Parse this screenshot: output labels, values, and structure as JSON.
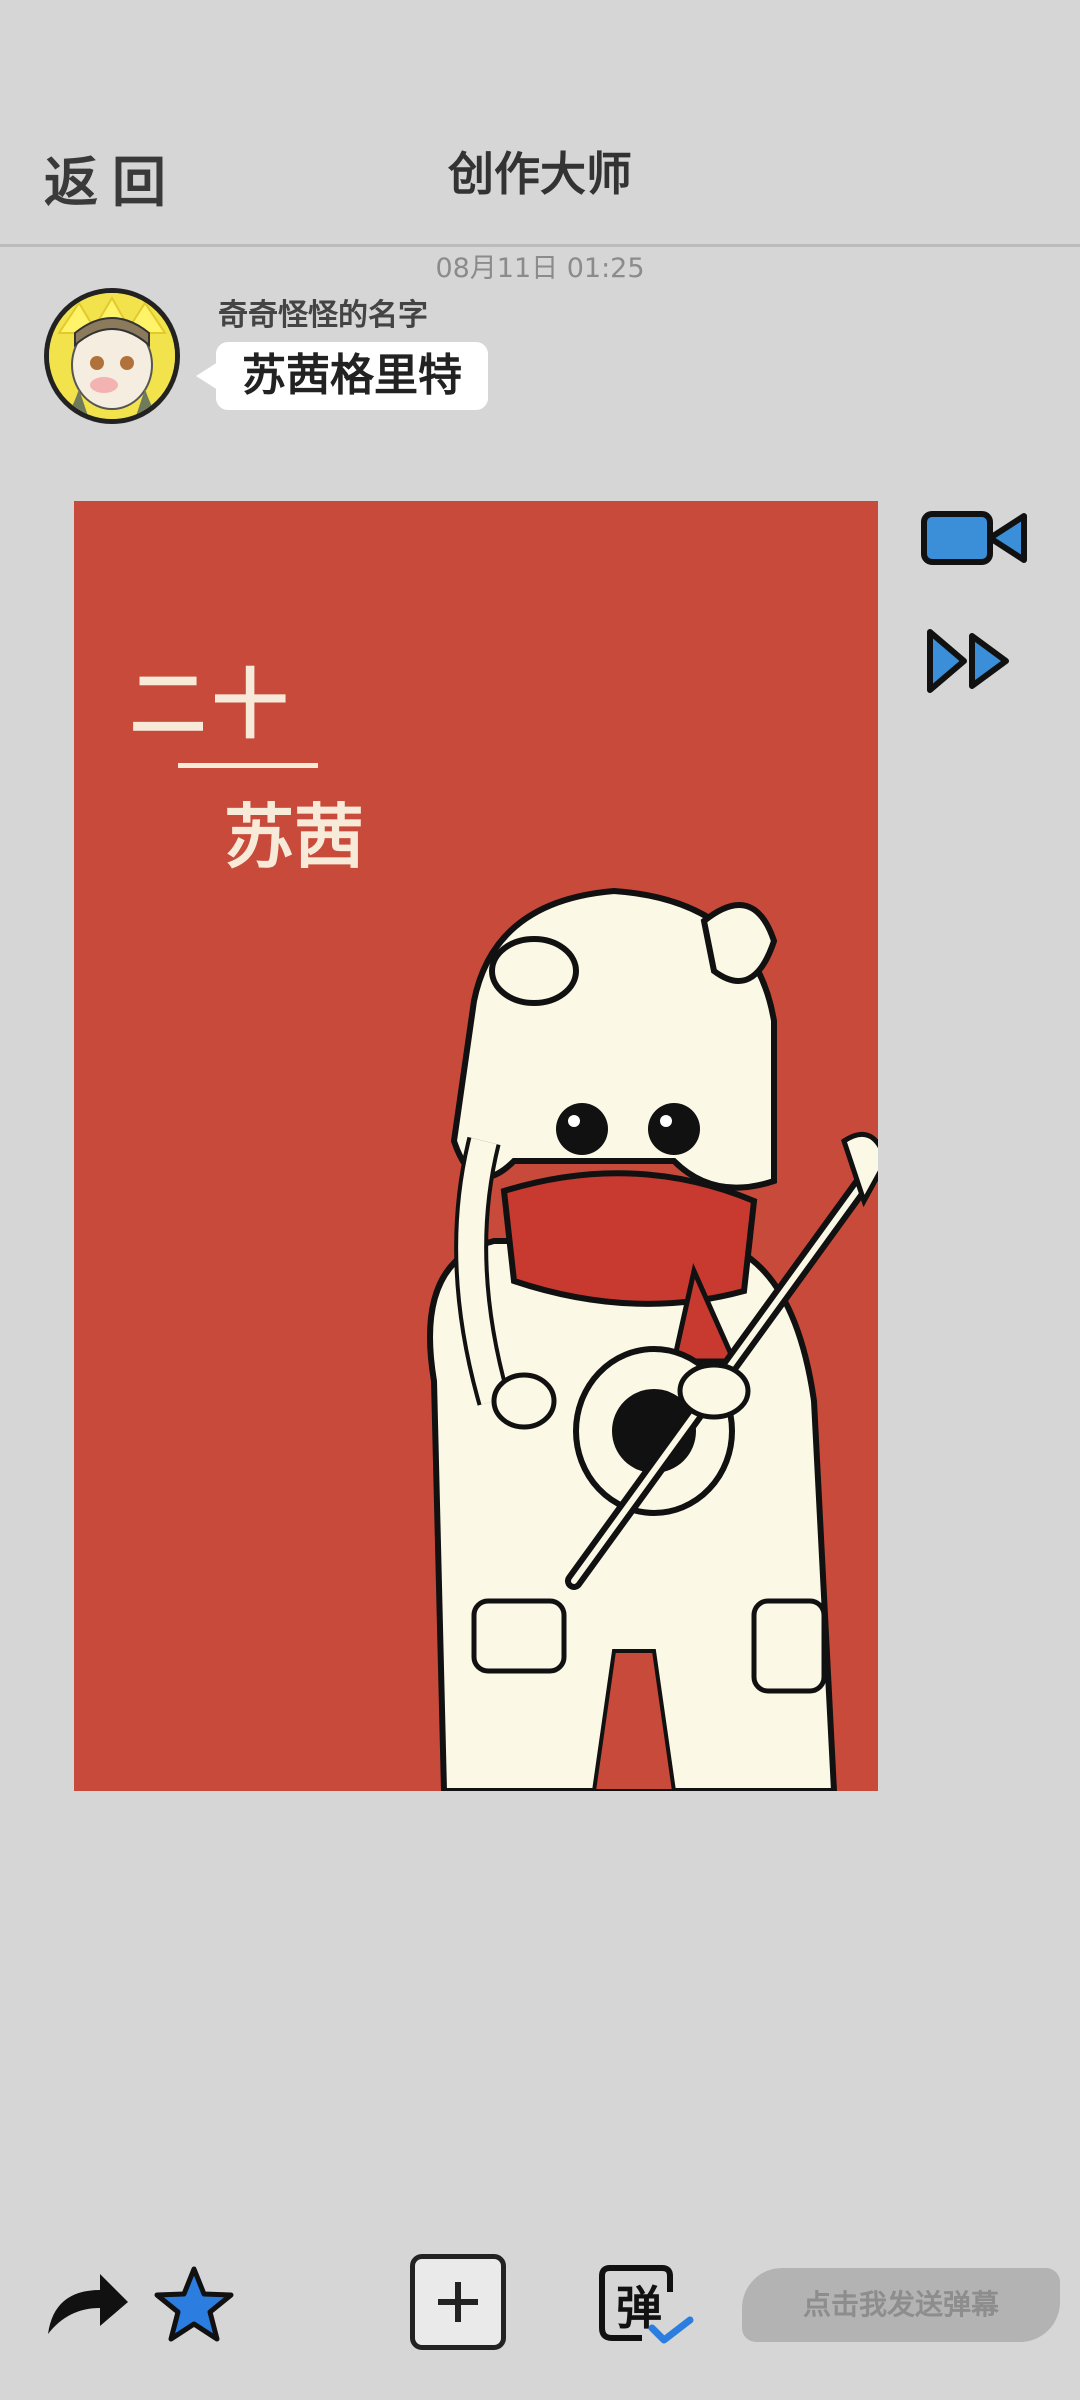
{
  "header": {
    "back_label": "返回",
    "title": "创作大师"
  },
  "post": {
    "timestamp": "08月11日  01:25",
    "username": "奇奇怪怪的名字",
    "message": "苏茜格里特"
  },
  "artwork": {
    "text_top": "二十",
    "text_bottom": "苏茜",
    "background_color": "#c84a3b"
  },
  "side_actions": [
    {
      "icon": "video-camera-icon",
      "color": "#3b8fd8"
    },
    {
      "icon": "fast-forward-icon",
      "color": "#3b8fd8"
    }
  ],
  "bottom_bar": {
    "share_icon": "share-arrow-icon",
    "favorite_icon": "star-icon",
    "add_icon": "plus-icon",
    "danmu_toggle_label": "弹",
    "danmu_placeholder": "点击我发送弹幕"
  },
  "colors": {
    "background": "#d6d6d6",
    "accent_blue": "#2c7de0"
  }
}
